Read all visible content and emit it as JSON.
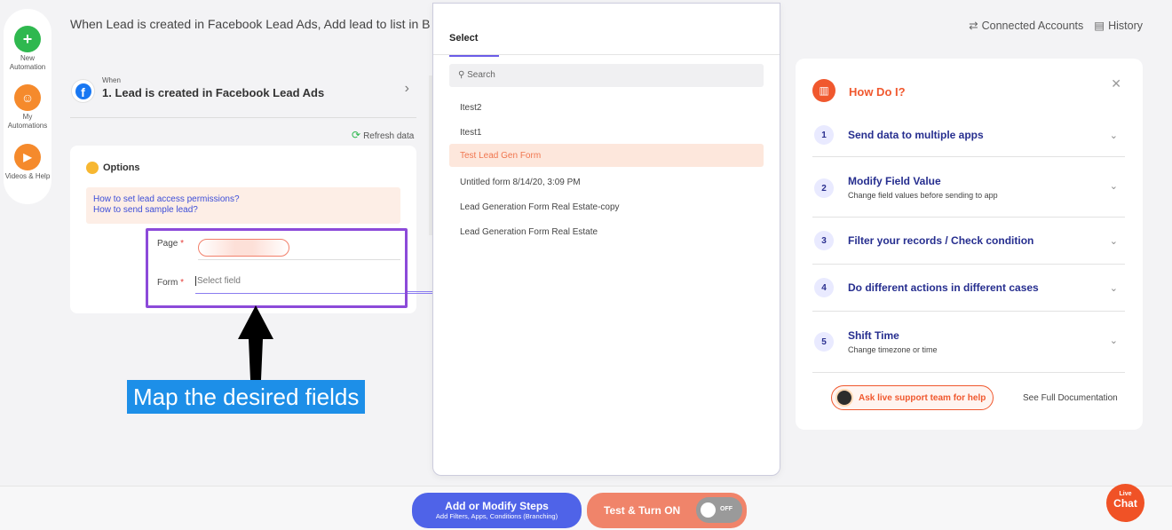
{
  "rail": {
    "new_automation": "New Automation",
    "my_automations": "My Automations",
    "videos_help": "Videos & Help"
  },
  "header": {
    "title": "When Lead is created in Facebook Lead Ads, Add lead to list in B",
    "connected_accounts": "Connected Accounts",
    "history": "History"
  },
  "trigger": {
    "when": "When",
    "name": "1. Lead is created in Facebook Lead Ads"
  },
  "refresh_label": "Refresh data",
  "options": {
    "heading": "Options",
    "help_link_1": "How to set lead access permissions?",
    "help_link_2": "How to send sample lead?",
    "page_label": "Page",
    "form_label": "Form",
    "form_placeholder": "Select field",
    "required_mark": "*"
  },
  "callout": "Map the desired fields",
  "dropdown": {
    "tab": "Select",
    "search_placeholder": "Search",
    "items": [
      "Itest2",
      "Itest1",
      "Test Lead Gen Form",
      "Untitled form 8/14/20, 3:09 PM",
      "Lead Generation Form Real Estate-copy",
      "Lead Generation Form Real Estate"
    ],
    "selected_index": 2
  },
  "help_panel": {
    "title": "How Do I?",
    "items": [
      {
        "num": "1",
        "label": "Send data to multiple apps",
        "sub": ""
      },
      {
        "num": "2",
        "label": "Modify Field Value",
        "sub": "Change field values before sending to app"
      },
      {
        "num": "3",
        "label": "Filter your records / Check condition",
        "sub": ""
      },
      {
        "num": "4",
        "label": "Do different actions in different cases",
        "sub": ""
      },
      {
        "num": "5",
        "label": "Shift Time",
        "sub": "Change timezone or time"
      }
    ],
    "support_button": "Ask live support team for help",
    "full_doc": "See Full Documentation"
  },
  "bottom": {
    "steps_line1": "Add or Modify Steps",
    "steps_line2": "Add Filters, Apps, Conditions (Branching)",
    "test_label": "Test & Turn ON",
    "toggle_state": "OFF"
  },
  "live_chat": {
    "line1": "Live",
    "line2": "Chat"
  },
  "colors": {
    "accent": "#f0582e",
    "primary_blue": "#4f63e8",
    "highlight_border": "#8c4ad9",
    "callout_bg": "#1d8fe8"
  }
}
